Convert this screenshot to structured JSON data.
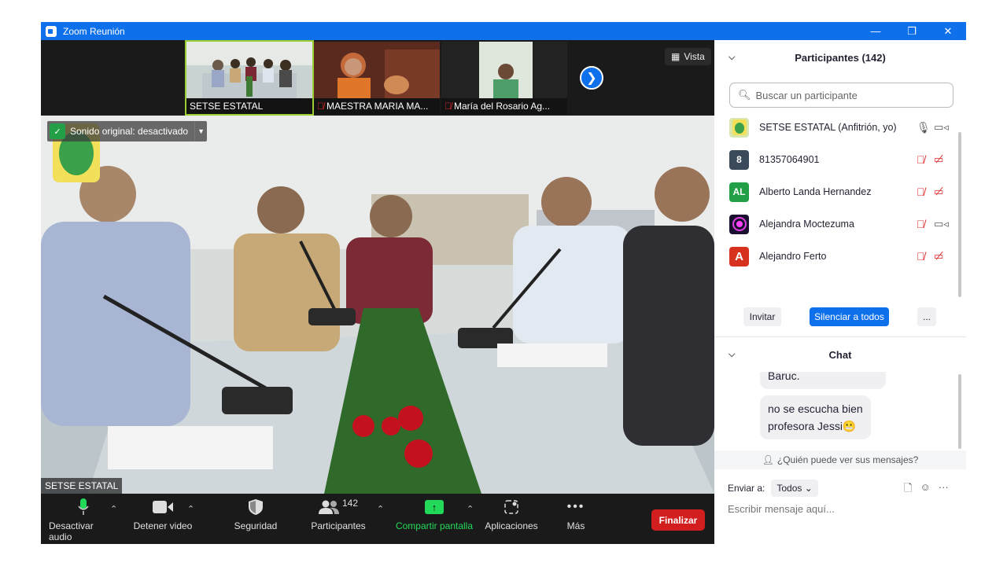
{
  "window": {
    "title": "Zoom Reunión",
    "minimize_glyph": "—",
    "restore_glyph": "❐",
    "close_glyph": "✕"
  },
  "thumbnails": [
    {
      "label": "SETSE ESTATAL",
      "muted": false,
      "active": true
    },
    {
      "label": "MAESTRA MARIA MA...",
      "muted": true,
      "active": false
    },
    {
      "label": "María del Rosario Ag...",
      "muted": true,
      "active": false
    }
  ],
  "view_button": {
    "label": "Vista"
  },
  "main_video": {
    "original_sound": "Sonido original: desactivado",
    "speaker_name": "SETSE ESTATAL"
  },
  "toolbar": {
    "mute_audio": "Desactivar audio",
    "stop_video": "Detener video",
    "security": "Seguridad",
    "participants": "Participantes",
    "participants_count": "142",
    "share_screen": "Compartir pantalla",
    "apps": "Aplicaciones",
    "more": "Más",
    "end": "Finalizar"
  },
  "participants_panel": {
    "title": "Participantes (142)",
    "search_placeholder": "Buscar un participante",
    "items": [
      {
        "name": "SETSE ESTATAL (Anfitrión, yo)",
        "avatar": "",
        "avatar_color": "#d9e6b0",
        "mic_muted": false,
        "cam_off": false
      },
      {
        "name": "81357064901",
        "avatar": "8",
        "avatar_color": "#3b4a5a",
        "mic_muted": true,
        "cam_off": true
      },
      {
        "name": "Alberto Landa Hernandez",
        "avatar": "AL",
        "avatar_color": "#23a047",
        "mic_muted": true,
        "cam_off": true
      },
      {
        "name": "Alejandra Moctezuma",
        "avatar": "",
        "avatar_color": "#3a1f5c",
        "mic_muted": true,
        "cam_off": false
      },
      {
        "name": "Alejandro Ferto",
        "avatar": "A",
        "avatar_color": "#d6321e",
        "mic_muted": true,
        "cam_off": true
      }
    ],
    "invite": "Invitar",
    "mute_all": "Silenciar a todos",
    "more": "..."
  },
  "chat_panel": {
    "title": "Chat",
    "messages": [
      "Baruc.",
      "no se escucha bien",
      "profesora Jessi😬"
    ],
    "who_can_see": "¿Quién puede ver sus mensajes?",
    "send_to_label": "Enviar a:",
    "send_to_value": "Todos",
    "input_placeholder": "Escribir mensaje aquí..."
  }
}
